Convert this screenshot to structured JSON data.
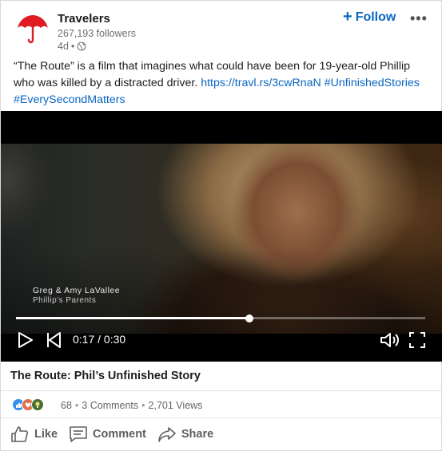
{
  "post": {
    "company_name": "Travelers",
    "followers": "267,193 followers",
    "age": "4d",
    "meta_separator": "•",
    "follow_label": "Follow",
    "follow_plus": "+",
    "more_label": "•••",
    "text_body": "“The Route” is a film that imagines what could have been for 19-year-old Phillip who was killed by a distracted driver. ",
    "link": "https://travl.rs/3cwRnaN",
    "hashtag_1": "#UnfinishedStories",
    "hashtag_2": "#EverySecondMatters"
  },
  "video": {
    "caption_name": "Greg & Amy LaVallee",
    "caption_role": "Phillip's Parents",
    "time": "0:17 / 0:30",
    "progress": 0.57,
    "title": "The Route: Phil’s Unfinished Story"
  },
  "social": {
    "reaction_count": "68",
    "separator": "•",
    "comments": "3 Comments",
    "views": "2,701 Views"
  },
  "actions": {
    "like": "Like",
    "comment": "Comment",
    "share": "Share"
  },
  "colors": {
    "brand_red": "#e01a22",
    "link_blue": "#0a66c2",
    "like_blue": "#378fe9",
    "love_red": "#df704d",
    "insightful_green": "#44712e"
  },
  "icons": {
    "logo": "umbrella-logo-icon",
    "visibility": "globe-icon",
    "play": "play-icon",
    "previous": "skip-back-icon",
    "volume": "volume-icon",
    "fullscreen": "fullscreen-icon",
    "like": "thumbs-up-icon",
    "comment": "comment-icon",
    "share": "share-arrow-icon"
  }
}
